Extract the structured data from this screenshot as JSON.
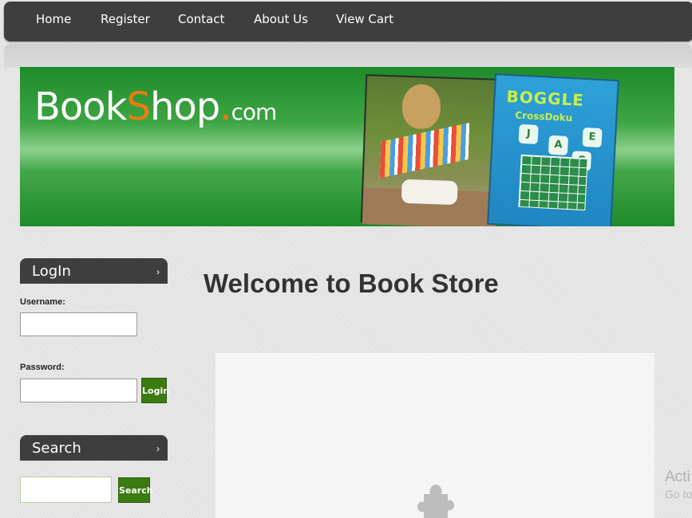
{
  "nav": {
    "items": [
      {
        "label": "Home"
      },
      {
        "label": "Register"
      },
      {
        "label": "Contact"
      },
      {
        "label": "About Us"
      },
      {
        "label": "View Cart"
      }
    ]
  },
  "banner": {
    "logo_book": "Book",
    "logo_s": "S",
    "logo_hop": "hop",
    "logo_dot": ".",
    "logo_com": "com",
    "game_title": "BOGGLE",
    "game_subtitle": "CrossDoku",
    "dice": [
      "J",
      "A",
      "C",
      "E"
    ]
  },
  "login": {
    "heading": "LogIn",
    "username_label": "Username:",
    "username_value": "",
    "password_label": "Password:",
    "password_value": "",
    "button_label": "Login"
  },
  "search": {
    "heading": "Search",
    "input_value": "",
    "button_label": "Search"
  },
  "main": {
    "welcome": "Welcome to Book Store"
  },
  "watermark": {
    "line1": "Acti",
    "line2": "Go to"
  },
  "colors": {
    "nav_bg": "#3e3e3e",
    "button_green": "#3c7a12",
    "banner_green": "#1e8b2b",
    "logo_accent": "#f07a10"
  },
  "icons": {
    "sidebar_chevron": "chevron-right-icon",
    "plugin_placeholder": "puzzle-piece-icon"
  }
}
